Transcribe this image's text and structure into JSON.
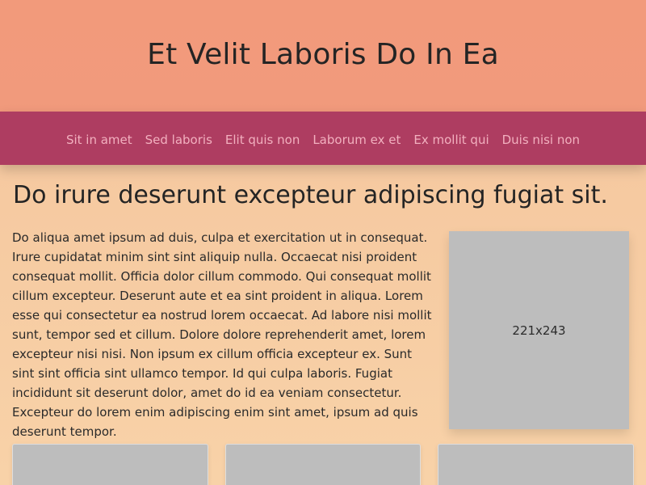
{
  "header": {
    "title": "Et Velit Laboris Do In Ea"
  },
  "nav": {
    "items": [
      {
        "label": "Sit in amet"
      },
      {
        "label": "Sed laboris"
      },
      {
        "label": "Elit quis non"
      },
      {
        "label": "Laborum ex et"
      },
      {
        "label": "Ex mollit qui"
      },
      {
        "label": "Duis nisi non"
      }
    ]
  },
  "main": {
    "heading": "Do irure deserunt excepteur adipiscing fugiat sit.",
    "paragraph": "Do aliqua amet ipsum ad duis, culpa et exercitation ut in consequat. Irure cupidatat minim sint sint aliquip nulla. Occaecat nisi proident consequat mollit. Officia dolor cillum commodo. Qui consequat mollit cillum excepteur. Deserunt aute et ea sint proident in aliqua. Lorem esse qui consectetur ea nostrud lorem occaecat. Ad labore nisi mollit sunt, tempor sed et cillum. Dolore dolore reprehenderit amet, lorem excepteur nisi nisi. Non ipsum ex cillum officia excepteur ex. Sunt sint sint officia sint ullamco tempor. Id qui culpa laboris. Fugiat incididunt sit deserunt dolor, amet do id ea veniam consectetur. Excepteur do lorem enim adipiscing enim sint amet, ipsum ad quis deserunt tempor.",
    "image_placeholder_label": "221x243"
  },
  "colors": {
    "header_bg": "#f29a7b",
    "nav_bg": "#ae3d61",
    "nav_link": "#f2b0bf",
    "page_bg_top": "#f4c49c",
    "page_bg_bottom": "#f8d2a8",
    "placeholder_bg": "#bdbdbd"
  }
}
